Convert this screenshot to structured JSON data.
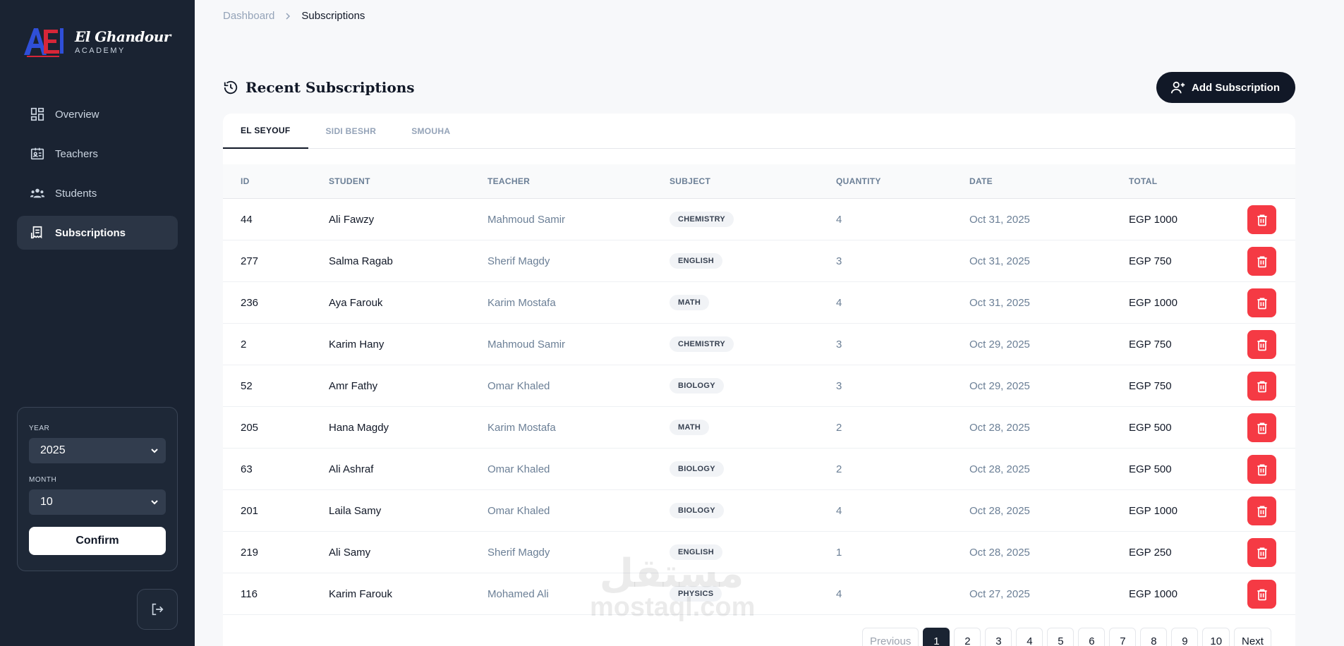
{
  "brand": {
    "name": "El Ghandour",
    "sub": "ACADEMY",
    "mark_text": "AEI"
  },
  "sidebar": {
    "items": [
      {
        "label": "Overview",
        "icon": "dashboard-icon",
        "active": false
      },
      {
        "label": "Teachers",
        "icon": "id-card-icon",
        "active": false
      },
      {
        "label": "Students",
        "icon": "users-icon",
        "active": false
      },
      {
        "label": "Subscriptions",
        "icon": "receipt-icon",
        "active": true
      }
    ],
    "filters": {
      "year_label": "YEAR",
      "year_value": "2025",
      "month_label": "MONTH",
      "month_value": "10",
      "confirm_label": "Confirm"
    }
  },
  "breadcrumb": {
    "parent": "Dashboard",
    "current": "Subscriptions"
  },
  "header": {
    "title": "Recent Subscriptions",
    "add_label": "Add Subscription"
  },
  "tabs": [
    {
      "label": "EL SEYOUF",
      "active": true
    },
    {
      "label": "SIDI BESHR",
      "active": false
    },
    {
      "label": "SMOUHA",
      "active": false
    }
  ],
  "table": {
    "columns": [
      "ID",
      "STUDENT",
      "TEACHER",
      "SUBJECT",
      "QUANTITY",
      "DATE",
      "TOTAL"
    ],
    "rows": [
      {
        "id": "44",
        "student": "Ali Fawzy",
        "teacher": "Mahmoud Samir",
        "subject": "CHEMISTRY",
        "quantity": "4",
        "date": "Oct 31, 2025",
        "total": "EGP 1000"
      },
      {
        "id": "277",
        "student": "Salma Ragab",
        "teacher": "Sherif Magdy",
        "subject": "ENGLISH",
        "quantity": "3",
        "date": "Oct 31, 2025",
        "total": "EGP 750"
      },
      {
        "id": "236",
        "student": "Aya Farouk",
        "teacher": "Karim Mostafa",
        "subject": "MATH",
        "quantity": "4",
        "date": "Oct 31, 2025",
        "total": "EGP 1000"
      },
      {
        "id": "2",
        "student": "Karim Hany",
        "teacher": "Mahmoud Samir",
        "subject": "CHEMISTRY",
        "quantity": "3",
        "date": "Oct 29, 2025",
        "total": "EGP 750"
      },
      {
        "id": "52",
        "student": "Amr Fathy",
        "teacher": "Omar Khaled",
        "subject": "BIOLOGY",
        "quantity": "3",
        "date": "Oct 29, 2025",
        "total": "EGP 750"
      },
      {
        "id": "205",
        "student": "Hana Magdy",
        "teacher": "Karim Mostafa",
        "subject": "MATH",
        "quantity": "2",
        "date": "Oct 28, 2025",
        "total": "EGP 500"
      },
      {
        "id": "63",
        "student": "Ali Ashraf",
        "teacher": "Omar Khaled",
        "subject": "BIOLOGY",
        "quantity": "2",
        "date": "Oct 28, 2025",
        "total": "EGP 500"
      },
      {
        "id": "201",
        "student": "Laila Samy",
        "teacher": "Omar Khaled",
        "subject": "BIOLOGY",
        "quantity": "4",
        "date": "Oct 28, 2025",
        "total": "EGP 1000"
      },
      {
        "id": "219",
        "student": "Ali Samy",
        "teacher": "Sherif Magdy",
        "subject": "ENGLISH",
        "quantity": "1",
        "date": "Oct 28, 2025",
        "total": "EGP 250"
      },
      {
        "id": "116",
        "student": "Karim Farouk",
        "teacher": "Mohamed Ali",
        "subject": "PHYSICS",
        "quantity": "4",
        "date": "Oct 27, 2025",
        "total": "EGP 1000"
      }
    ]
  },
  "pagination": {
    "previous": "Previous",
    "next": "Next",
    "pages": [
      "1",
      "2",
      "3",
      "4",
      "5",
      "6",
      "7",
      "8",
      "9",
      "10"
    ],
    "current": "1"
  },
  "watermark": {
    "arabic": "مستقل",
    "latin": "mostaql.com"
  },
  "colors": {
    "sidebar_bg": "#1a2332",
    "danger": "#f53a44",
    "primary": "#111827"
  }
}
